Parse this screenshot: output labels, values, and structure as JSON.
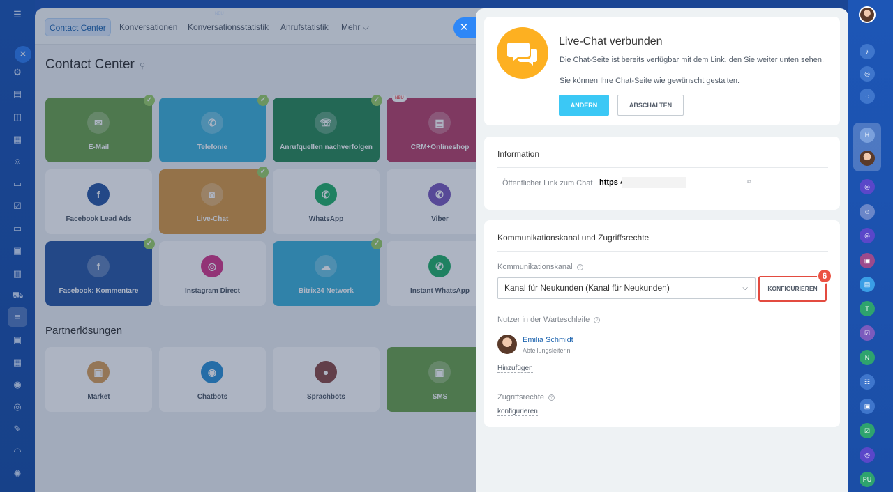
{
  "topnav": {
    "tabs": [
      "Contact Center",
      "Konversationen",
      "Konversationsstatistik",
      "Anrufstatistik",
      "Mehr ⌵"
    ],
    "neu_marker": "NEU"
  },
  "page_title": "Contact Center",
  "tiles": [
    {
      "label": "E-Mail",
      "color": "#6ea34d",
      "checked": true,
      "icon": "envelope-icon"
    },
    {
      "label": "Telefonie",
      "color": "#3fb2d9",
      "checked": true,
      "icon": "phone-icon"
    },
    {
      "label": "Anrufquellen nachverfolgen",
      "color": "#2b8a58",
      "checked": true,
      "icon": "call-tracking-icon"
    },
    {
      "label": "CRM+Onlineshop",
      "color": "#b9436a",
      "checked": false,
      "badge": "NEU",
      "icon": "shop-icon"
    },
    {
      "label": "Facebook Lead Ads",
      "color": "#ffffff",
      "checked": false,
      "icon": "facebook-leads-icon"
    },
    {
      "label": "Live-Chat",
      "color": "#d99a45",
      "checked": true,
      "icon": "chat-icon"
    },
    {
      "label": "WhatsApp",
      "color": "#ffffff",
      "checked": false,
      "icon": "whatsapp-icon"
    },
    {
      "label": "Viber",
      "color": "#ffffff",
      "checked": false,
      "icon": "viber-icon"
    },
    {
      "label": "Facebook: Kommentare",
      "color": "#2c5aa5",
      "checked": true,
      "icon": "facebook-comments-icon"
    },
    {
      "label": "Instagram Direct",
      "color": "#ffffff",
      "checked": false,
      "icon": "instagram-icon"
    },
    {
      "label": "Bitrix24 Network",
      "color": "#3fb2d9",
      "checked": true,
      "icon": "cloud-icon"
    },
    {
      "label": "Instant WhatsApp",
      "color": "#ffffff",
      "checked": false,
      "icon": "whatsapp-icon"
    }
  ],
  "partner_title": "Partnerlösungen",
  "partner_tiles": [
    {
      "label": "Market",
      "color": "#ffffff",
      "icon": "box-icon"
    },
    {
      "label": "Chatbots",
      "color": "#ffffff",
      "icon": "robot-icon"
    },
    {
      "label": "Sprachbots",
      "color": "#ffffff",
      "icon": "microphone-icon"
    },
    {
      "label": "SMS",
      "color": "#6ea34d",
      "icon": "sms-icon"
    }
  ],
  "panel": {
    "status": {
      "title": "Live-Chat verbunden",
      "line1": "Die Chat-Seite ist bereits verfügbar mit dem Link, den Sie weiter unten sehen.",
      "line2": "Sie können Ihre Chat-Seite wie gewünscht gestalten.",
      "change_button": "ÄNDERN",
      "disable_button": "ABSCHALTEN"
    },
    "information": {
      "title": "Information",
      "public_link_label": "Öffentlicher Link zum Chat",
      "public_link_value": "https                              4.de/online/chat"
    },
    "channel": {
      "title": "Kommunikationskanal und Zugriffsrechte",
      "channel_label": "Kommunikationskanal",
      "channel_value": "Kanal für Neukunden (Kanal für Neukunden)",
      "configure_button": "KONFIGURIEREN",
      "step_badge": "6",
      "queue_label": "Nutzer in der Warteschleife",
      "user_name": "Emilia Schmidt",
      "user_role": "Abteilungsleiterin",
      "add_link": "Hinzufügen",
      "access_label": "Zugriffsrechte",
      "access_link": "konfigurieren"
    }
  },
  "right_rail": {
    "letters": [
      "H",
      "T",
      "N",
      "PU"
    ]
  },
  "colors": {
    "accent": "#3bc8f5",
    "highlight": "#e34b40",
    "rail": "#1d56b6"
  }
}
